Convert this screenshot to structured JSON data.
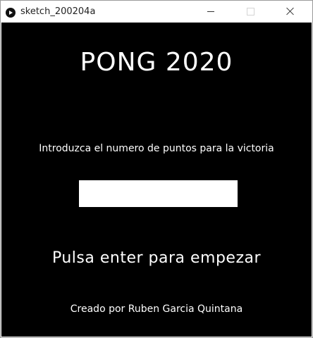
{
  "window": {
    "title": "sketch_200204a",
    "icons": {
      "app": "processing-play-icon",
      "minimize": "minimize-icon",
      "maximize": "maximize-icon",
      "close": "close-icon"
    }
  },
  "game": {
    "title": "PONG 2020",
    "prompt": "Introduzca el numero de puntos para la victoria",
    "points_input_value": "",
    "start_instruction": "Pulsa enter para empezar",
    "credits": "Creado por Ruben Garcia Quintana"
  },
  "colors": {
    "canvas_background": "#000000",
    "text": "#ffffff",
    "input_background": "#ffffff"
  }
}
